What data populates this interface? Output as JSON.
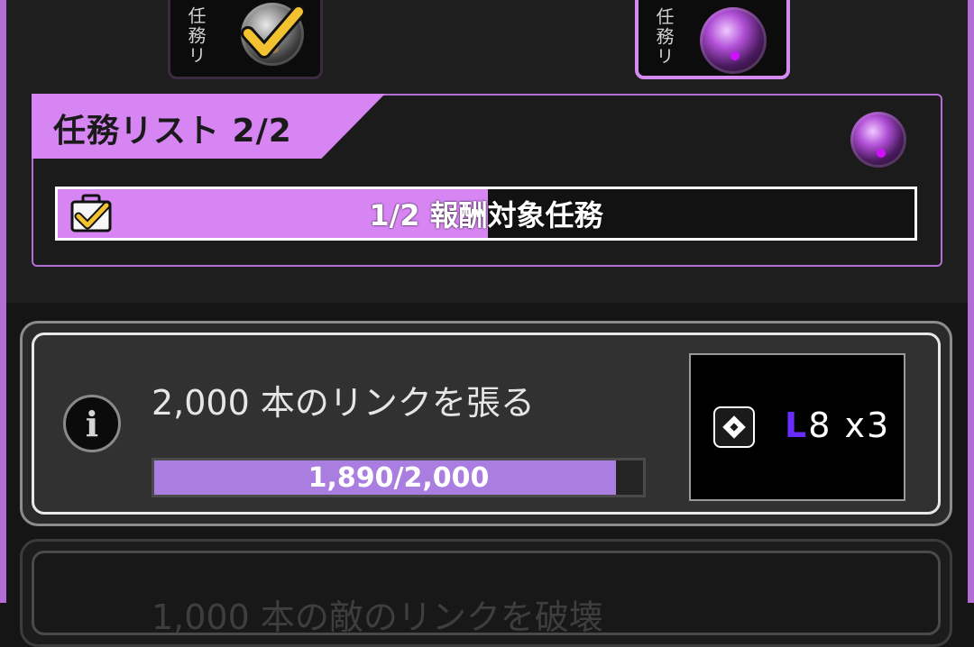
{
  "tabs": [
    {
      "label": "任務リ"
    },
    {
      "label": "任務リ"
    }
  ],
  "task_list": {
    "title": "任務リスト 2/2",
    "progress_text": "1/2 報酬対象任務",
    "progress_fraction": 0.5
  },
  "missions": [
    {
      "title": "2,000 本のリンクを張る",
      "progress_text": "1,890/2,000",
      "progress_fraction": 0.945,
      "reward_level_prefix": "L",
      "reward_level_number": "8",
      "reward_quantity": "x3"
    },
    {
      "title": "1,000 本の敵のリンクを破壊"
    }
  ],
  "colors": {
    "accent": "#d685f3",
    "border": "#b56dd6",
    "bar_fill": "#a97ee0"
  }
}
